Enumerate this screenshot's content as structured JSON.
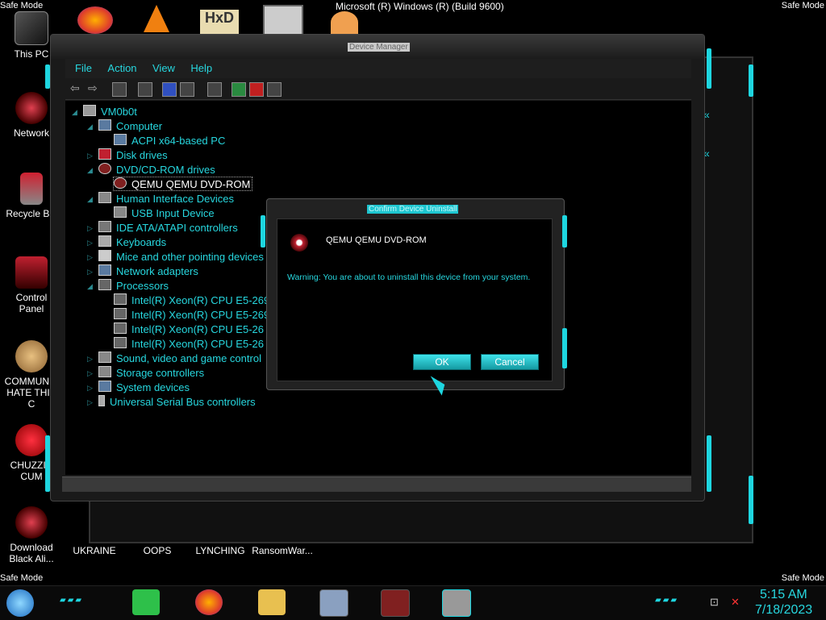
{
  "desktop": {
    "safe_mode": "Safe Mode",
    "build_text": "Microsoft (R) Windows (R) (Build 9600)",
    "icons": [
      {
        "label": "This PC",
        "icon": "computer-icon"
      },
      {
        "label": "Network",
        "icon": "network-icon"
      },
      {
        "label": "Recycle Bin",
        "icon": "recycle-bin-icon"
      },
      {
        "label": "Control Panel",
        "icon": "control-panel-icon"
      },
      {
        "label": "COMMUNIS HATE THIS C",
        "icon": "money-bag-icon"
      },
      {
        "label": "CHUZZIN CUM",
        "icon": "chuzzle-icon"
      },
      {
        "label": "Download Black Ali...",
        "icon": "download-icon"
      },
      {
        "label": "UKRAINE",
        "icon": "red-icon"
      },
      {
        "label": "OOPS",
        "icon": "oops-icon"
      },
      {
        "label": "LYNCHING",
        "icon": "lynching-icon"
      },
      {
        "label": "RansomWar...",
        "icon": "ransomware-icon"
      }
    ]
  },
  "device_manager": {
    "title": "Device Manager",
    "menu": [
      "File",
      "Action",
      "View",
      "Help"
    ],
    "tree": {
      "root": "VM0b0t",
      "computer": "Computer",
      "acpi": "ACPI x64-based PC",
      "disk_drives": "Disk drives",
      "dvd_drives": "DVD/CD-ROM drives",
      "dvd_device": "QEMU QEMU DVD-ROM",
      "hid": "Human Interface Devices",
      "usb_input": "USB Input Device",
      "ide": "IDE ATA/ATAPI controllers",
      "keyboards": "Keyboards",
      "mice": "Mice and other pointing devices",
      "network": "Network adapters",
      "processors": "Processors",
      "cpu1": "Intel(R) Xeon(R) CPU E5-269",
      "cpu2": "Intel(R) Xeon(R) CPU E5-269",
      "cpu3": "Intel(R) Xeon(R) CPU E5-26",
      "cpu4": "Intel(R) Xeon(R) CPU E5-26",
      "sound": "Sound, video and game control",
      "storage": "Storage controllers",
      "system": "System devices",
      "usb": "Universal Serial Bus controllers"
    }
  },
  "dialog": {
    "title": "Confirm Device Uninstall",
    "device_name": "QEMU QEMU DVD-ROM",
    "warning": "Warning: You are about to uninstall this device from your system.",
    "ok": "OK",
    "cancel": "Cancel"
  },
  "taskbar": {
    "time": "5:15 AM",
    "date": "7/18/2023",
    "apps": [
      "start-orb-icon",
      "notes-icon",
      "firefox-icon",
      "file-explorer-icon",
      "task-manager-icon",
      "app-icon",
      "device-manager-icon"
    ]
  },
  "colors": {
    "accent": "#27d7df",
    "button": "#1ec6d0"
  }
}
